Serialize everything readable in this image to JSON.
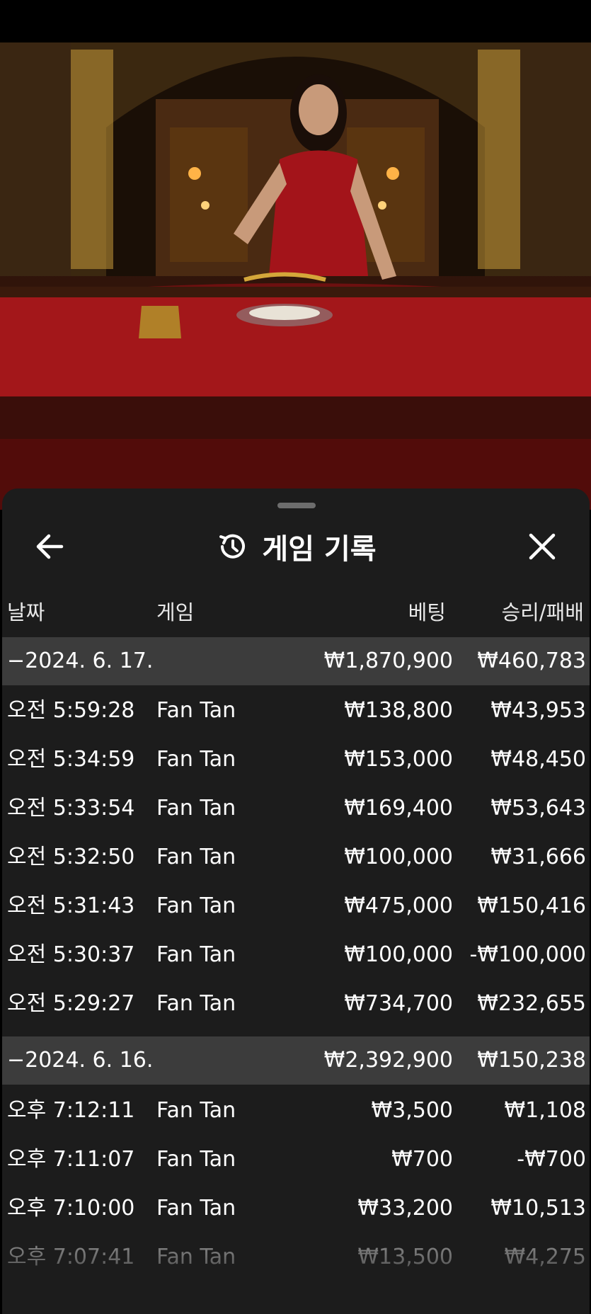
{
  "header": {
    "title": "게임 기록",
    "back_icon": "arrow-left-icon",
    "history_icon": "history-icon",
    "close_icon": "close-icon"
  },
  "columns": {
    "date": "날짜",
    "game": "게임",
    "bet": "베팅",
    "win_loss": "승리/패배"
  },
  "groups": [
    {
      "date": "−2024. 6. 17.",
      "bet_total": "₩1,870,900",
      "win_total": "₩460,783",
      "rows": [
        {
          "time": "오전 5:59:28",
          "game": "Fan Tan",
          "bet": "₩138,800",
          "win": "₩43,953"
        },
        {
          "time": "오전 5:34:59",
          "game": "Fan Tan",
          "bet": "₩153,000",
          "win": "₩48,450"
        },
        {
          "time": "오전 5:33:54",
          "game": "Fan Tan",
          "bet": "₩169,400",
          "win": "₩53,643"
        },
        {
          "time": "오전 5:32:50",
          "game": "Fan Tan",
          "bet": "₩100,000",
          "win": "₩31,666"
        },
        {
          "time": "오전 5:31:43",
          "game": "Fan Tan",
          "bet": "₩475,000",
          "win": "₩150,416"
        },
        {
          "time": "오전 5:30:37",
          "game": "Fan Tan",
          "bet": "₩100,000",
          "win": "-₩100,000"
        },
        {
          "time": "오전 5:29:27",
          "game": "Fan Tan",
          "bet": "₩734,700",
          "win": "₩232,655"
        }
      ]
    },
    {
      "date": "−2024. 6. 16.",
      "bet_total": "₩2,392,900",
      "win_total": "₩150,238",
      "rows": [
        {
          "time": "오후 7:12:11",
          "game": "Fan Tan",
          "bet": "₩3,500",
          "win": "₩1,108"
        },
        {
          "time": "오후 7:11:07",
          "game": "Fan Tan",
          "bet": "₩700",
          "win": "-₩700"
        },
        {
          "time": "오후 7:10:00",
          "game": "Fan Tan",
          "bet": "₩33,200",
          "win": "₩10,513"
        },
        {
          "time": "오후 7:07:41",
          "game": "Fan Tan",
          "bet": "₩13,500",
          "win": "₩4,275"
        }
      ]
    }
  ]
}
